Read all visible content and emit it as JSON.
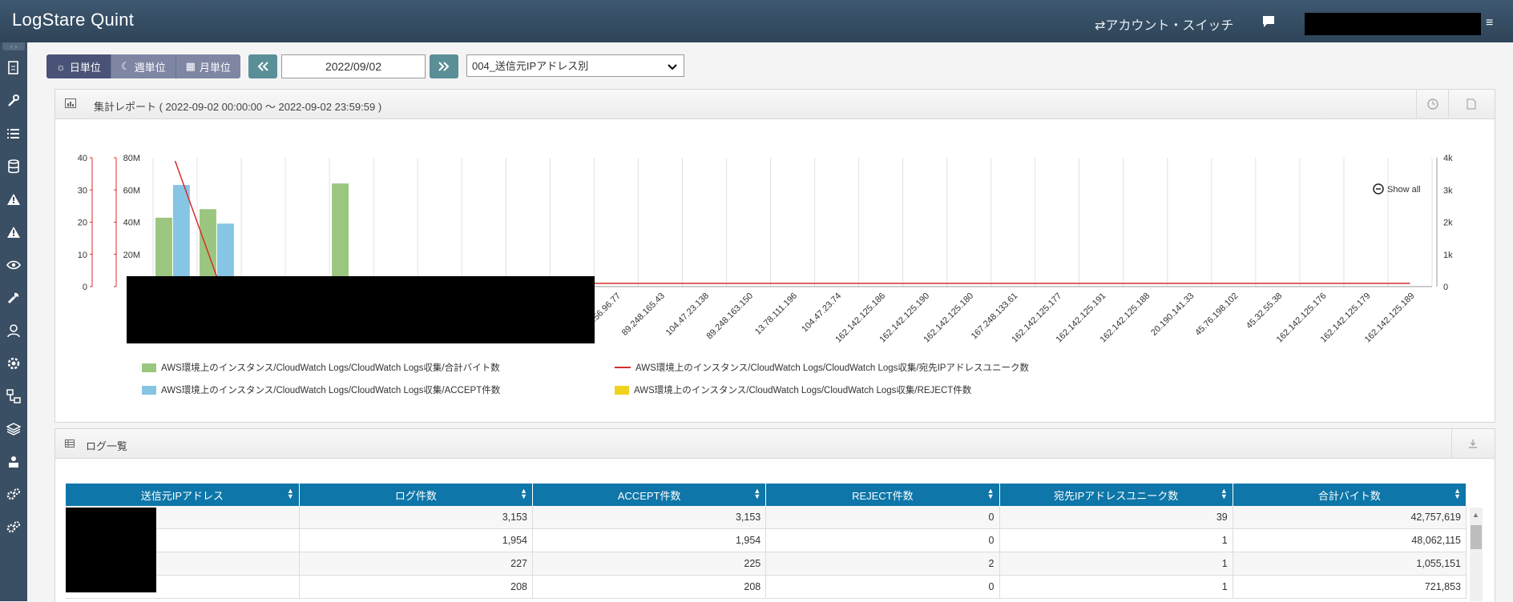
{
  "app": {
    "title": "LogStare Quint"
  },
  "header": {
    "account_switch": "⇄アカウント・スイッチ"
  },
  "sidebar": {
    "items": [
      "report-icon",
      "wrench-icon",
      "list-icon",
      "database-icon",
      "alert-icon",
      "alert-icon-2",
      "eye-icon",
      "tool-icon",
      "users-icon",
      "settings-icon",
      "network-icon",
      "layers-icon",
      "user-group-icon",
      "cogs-icon",
      "cogs-icon-2"
    ]
  },
  "toolbar": {
    "period_buttons": [
      "日単位",
      "週単位",
      "月単位"
    ],
    "date": "2022/09/02",
    "report_select": "004_送信元IPアドレス別"
  },
  "report_panel": {
    "title": "集計レポート ( 2022-09-02 00:00:00 ～ 2022-09-02 23:59:59 )",
    "show_all": "Show all",
    "legend": [
      "AWS環境上のインスタンス/CloudWatch Logs/CloudWatch Logs収集/合計バイト数",
      "AWS環境上のインスタンス/CloudWatch Logs/CloudWatch Logs収集/宛先IPアドレスユニーク数",
      "AWS環境上のインスタンス/CloudWatch Logs/CloudWatch Logs収集/ACCEPT件数",
      "AWS環境上のインスタンス/CloudWatch Logs/CloudWatch Logs収集/REJECT件数"
    ]
  },
  "colors": {
    "bytes": "#9bc67f",
    "accept": "#86c5e3",
    "unique": "#d62e2e",
    "reject": "#f0d31e",
    "header": "#0e76a8"
  },
  "chart_data": {
    "type": "bar",
    "categories": [
      "",
      "",
      "",
      "",
      "",
      "",
      "",
      "",
      "",
      "",
      "45.56.96.77",
      "89.248.165.43",
      "104.47.23.138",
      "89.248.163.150",
      "13.78.111.196",
      "104.47.23.74",
      "162.142.125.186",
      "162.142.125.190",
      "162.142.125.180",
      "167.248.133.61",
      "162.142.125.177",
      "162.142.125.191",
      "162.142.125.188",
      "20.190.141.33",
      "45.76.198.102",
      "45.32.55.38",
      "162.142.125.176",
      "162.142.125.179",
      "162.142.125.189"
    ],
    "series": [
      {
        "name": "AWS環境上のインスタンス/CloudWatch Logs/CloudWatch Logs収集/合計バイト数",
        "axis": "left_bytes",
        "values": [
          42757619,
          48062115,
          1055151,
          721853,
          64000000,
          300000,
          200000,
          150000,
          120000,
          100000,
          0,
          0,
          0,
          0,
          0,
          0,
          0,
          0,
          0,
          0,
          0,
          0,
          0,
          0,
          0,
          0,
          0,
          0,
          0
        ]
      },
      {
        "name": "AWS環境上のインスタンス/CloudWatch Logs/CloudWatch Logs収集/ACCEPT件数",
        "axis": "left_count",
        "values": [
          3153,
          1954,
          225,
          208,
          195,
          180,
          90,
          40,
          30,
          20,
          0,
          0,
          0,
          0,
          0,
          0,
          0,
          0,
          0,
          0,
          0,
          0,
          0,
          0,
          0,
          0,
          0,
          0,
          0
        ]
      },
      {
        "name": "AWS環境上のインスタンス/CloudWatch Logs/CloudWatch Logs収集/宛先IPアドレスユニーク数",
        "axis": "left_unique",
        "values": [
          39,
          1,
          1,
          1,
          1,
          1,
          1,
          1,
          1,
          1,
          1,
          1,
          1,
          1,
          1,
          1,
          1,
          1,
          1,
          1,
          1,
          1,
          1,
          1,
          1,
          1,
          1,
          1,
          1
        ]
      },
      {
        "name": "AWS環境上のインスタンス/CloudWatch Logs/CloudWatch Logs収集/REJECT件数",
        "axis": "left_count",
        "values": [
          0,
          0,
          2,
          0,
          0,
          0,
          0,
          0,
          0,
          0,
          0,
          0,
          0,
          0,
          0,
          0,
          0,
          0,
          0,
          0,
          0,
          0,
          0,
          0,
          0,
          0,
          0,
          0,
          0
        ]
      }
    ],
    "y_left_unique": {
      "ticks": [
        "40",
        "30",
        "20",
        "10",
        "0"
      ],
      "range": [
        0,
        40
      ]
    },
    "y_left_bytes": {
      "ticks": [
        "80M",
        "60M",
        "40M",
        "20M",
        "0"
      ],
      "range": [
        0,
        80000000
      ]
    },
    "y_right_count": {
      "ticks": [
        "4k",
        "3k",
        "2k",
        "1k",
        "0"
      ],
      "range": [
        0,
        4000
      ]
    }
  },
  "log_panel": {
    "title": "ログ一覧",
    "columns": [
      "送信元IPアドレス",
      "ログ件数",
      "ACCEPT件数",
      "REJECT件数",
      "宛先IPアドレスユニーク数",
      "合計バイト数"
    ],
    "rows": [
      [
        "",
        "3,153",
        "3,153",
        "0",
        "39",
        "42,757,619"
      ],
      [
        "",
        "1,954",
        "1,954",
        "0",
        "1",
        "48,062,115"
      ],
      [
        "",
        "227",
        "225",
        "2",
        "1",
        "1,055,151"
      ],
      [
        "",
        "208",
        "208",
        "0",
        "1",
        "721,853"
      ]
    ]
  }
}
